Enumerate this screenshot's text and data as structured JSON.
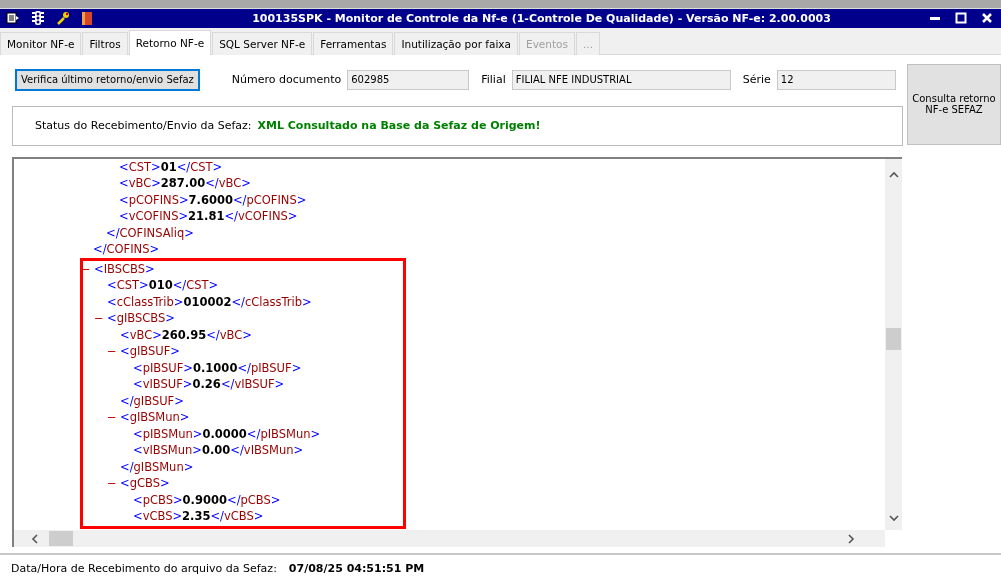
{
  "window": {
    "title": "100135SPK - Monitor de Controle da Nf-e (1-Controle De Qualidade) - Versão NF-e: 2.00.0003"
  },
  "tabs": [
    {
      "label": "Monitor NF-e",
      "selected": false,
      "disabled": false
    },
    {
      "label": "Filtros",
      "selected": false,
      "disabled": false
    },
    {
      "label": "Retorno NF-e",
      "selected": true,
      "disabled": false
    },
    {
      "label": "SQL Server NF-e",
      "selected": false,
      "disabled": false
    },
    {
      "label": "Ferramentas",
      "selected": false,
      "disabled": false
    },
    {
      "label": "Inutilização por faixa",
      "selected": false,
      "disabled": false
    },
    {
      "label": "Eventos",
      "selected": false,
      "disabled": true
    },
    {
      "label": "...",
      "selected": false,
      "disabled": true
    }
  ],
  "verify_button": "Verifica último retorno/envio Sefaz",
  "fields": [
    {
      "label": "Número documento",
      "value": "602985"
    },
    {
      "label": "Filial",
      "value": "FILIAL NFE INDUSTRIAL"
    },
    {
      "label": "Série",
      "value": "12"
    }
  ],
  "consult_button": "Consulta retorno NF-e SEFAZ",
  "status": {
    "label": "Status do Recebimento/Envio da Sefaz:",
    "message": "XML Consultado na Base da Sefaz de Origem!"
  },
  "xml": [
    {
      "children": [
        {
          "children": [
            {
              "text": "<CST>**01**</CST>"
            },
            {
              "text": "<vBC>**287.00**</vBC>"
            },
            {
              "text": "<pCOFINS>**7.6000**</pCOFINS>"
            },
            {
              "text": "<vCOFINS>**21.81**</vCOFINS>"
            }
          ],
          "close": "</COFINSAliq>"
        }
      ],
      "close": "</COFINS>"
    },
    {
      "toggle": "−",
      "open": "<IBSCBS>",
      "highlighted": true,
      "children": [
        {
          "text": "<CST>**010**</CST>"
        },
        {
          "text": "<cClassTrib>**010002**</cClassTrib>"
        },
        {
          "toggle": "−",
          "open": "<gIBSCBS>",
          "children": [
            {
              "text": "<vBC>**260.95**</vBC>"
            },
            {
              "toggle": "−",
              "open": "<gIBSUF>",
              "children": [
                {
                  "text": "<pIBSUF>**0.1000**</pIBSUF>"
                },
                {
                  "text": "<vIBSUF>**0.26**</vIBSUF>"
                }
              ],
              "close": "</gIBSUF>"
            },
            {
              "toggle": "−",
              "open": "<gIBSMun>",
              "children": [
                {
                  "text": "<pIBSMun>**0.0000**</pIBSMun>"
                },
                {
                  "text": "<vIBSMun>**0.00**</vIBSMun>"
                }
              ],
              "close": "</gIBSMun>"
            },
            {
              "toggle": "−",
              "open": "<gCBS>",
              "children": [
                {
                  "text": "<pCBS>**0.9000**</pCBS>"
                },
                {
                  "text": "<vCBS>**2.35**</vCBS>"
                }
              ]
            }
          ]
        }
      ]
    }
  ],
  "footer": {
    "label": "Data/Hora de Recebimento do arquivo da Sefaz:",
    "value": "07/08/25 04:51:51 PM"
  }
}
